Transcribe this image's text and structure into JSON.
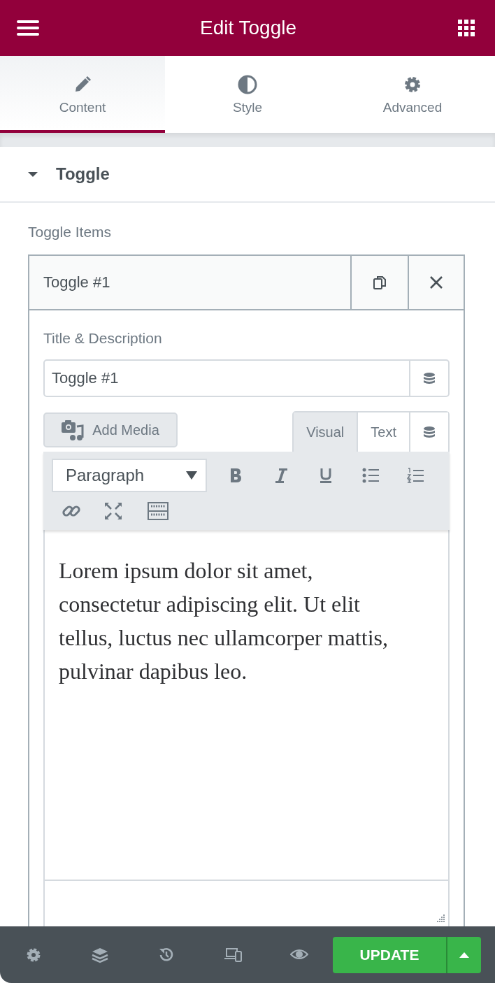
{
  "header": {
    "title": "Edit Toggle"
  },
  "tabs": [
    {
      "label": "Content",
      "selected": true
    },
    {
      "label": "Style",
      "selected": false
    },
    {
      "label": "Advanced",
      "selected": false
    }
  ],
  "section": {
    "title": "Toggle",
    "expanded": true
  },
  "repeater": {
    "label": "Toggle Items",
    "items": [
      {
        "title": "Toggle #1",
        "field_label": "Title & Description",
        "title_value": "Toggle #1",
        "add_media": "Add Media",
        "editor_modes": [
          {
            "label": "Visual",
            "selected": true
          },
          {
            "label": "Text",
            "selected": false
          }
        ],
        "format": "Paragraph",
        "content": "Lorem ipsum dolor sit amet, consectetur adipiscing elit. Ut elit tellus, luctus nec ullamcorper mattis, pulvinar dapibus leo."
      }
    ]
  },
  "footer": {
    "update_label": "UPDATE"
  }
}
